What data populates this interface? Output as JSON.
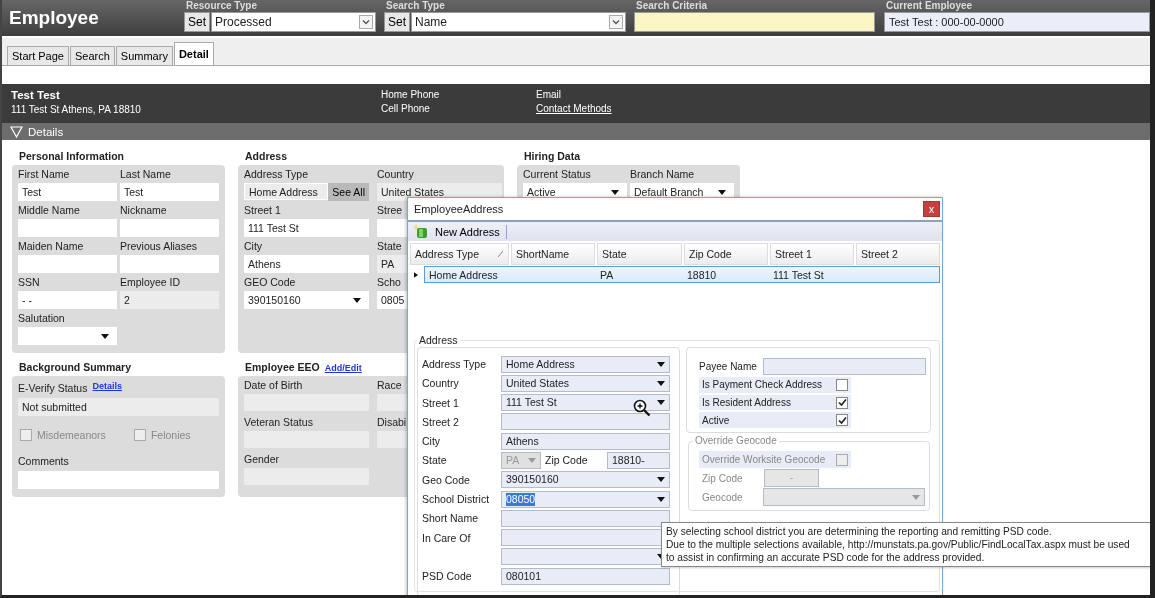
{
  "header": {
    "title": "Employee",
    "groups": [
      {
        "label": "Resource Type",
        "kind": "select",
        "button": "Set",
        "value": "Processed"
      },
      {
        "label": "Search Type",
        "kind": "select",
        "button": "Set",
        "value": "Name"
      },
      {
        "label": "Search Criteria",
        "kind": "input"
      },
      {
        "label": "Current Employee",
        "kind": "display",
        "value": "Test  Test : 000-00-0000"
      }
    ]
  },
  "tabs": [
    {
      "label": "Start Page",
      "selected": false
    },
    {
      "label": "Search",
      "selected": false
    },
    {
      "label": "Summary",
      "selected": false
    },
    {
      "label": "Detail",
      "selected": true
    }
  ],
  "employee": {
    "name": "Test Test",
    "address": "111 Test St Athens, PA 18810",
    "phone_labels": [
      "Home Phone",
      "Cell Phone"
    ],
    "email_label": "Email",
    "contact_link": "Contact Methods"
  },
  "details_bar": {
    "label": "Details",
    "expanded": true
  },
  "personal_information": {
    "title": "Personal Information",
    "fields": [
      {
        "label": "First Name",
        "kind": "input",
        "value": "Test"
      },
      {
        "label": "Last Name",
        "kind": "input",
        "value": "Test"
      },
      {
        "label": "Middle Name",
        "kind": "input"
      },
      {
        "label": "Nickname",
        "kind": "input"
      },
      {
        "label": "Maiden Name",
        "kind": "input"
      },
      {
        "label": "Previous Aliases",
        "kind": "input"
      },
      {
        "label": "SSN",
        "kind": "input",
        "value": "-   -"
      },
      {
        "label": "Employee ID",
        "kind": "readonly",
        "value": "2"
      },
      {
        "label": "Salutation",
        "kind": "select"
      }
    ]
  },
  "address": {
    "title": "Address",
    "fields": [
      {
        "label": "Address Type",
        "kind": "button-field",
        "value": "Home Address",
        "button": "See All"
      },
      {
        "label": "Country",
        "kind": "readonly",
        "value": "United States"
      },
      {
        "label": "Street 1",
        "kind": "input",
        "value": "111 Test St"
      },
      {
        "label": "Stree",
        "kind": "input"
      },
      {
        "label": "City",
        "kind": "input",
        "value": "Athens"
      },
      {
        "label": "State",
        "kind": "readonly",
        "value": "PA"
      },
      {
        "label": "GEO Code",
        "kind": "select",
        "value": "390150160"
      },
      {
        "label": "Scho",
        "kind": "input",
        "value": "0805"
      }
    ]
  },
  "hiring_data": {
    "title": "Hiring Data",
    "fields": [
      {
        "label": "Current Status",
        "kind": "select",
        "value": "Active"
      },
      {
        "label": "Branch Name",
        "kind": "select",
        "value": "Default Branch"
      }
    ]
  },
  "background_summary": {
    "title": "Background Summary",
    "everify_label": "E-Verify Status",
    "details_link": "Details",
    "everify_value": "Not submitted",
    "checks": [
      {
        "label": "Misdemeanors",
        "checked": false,
        "disabled": true
      },
      {
        "label": "Felonies",
        "checked": false,
        "disabled": true
      }
    ],
    "comments_label": "Comments"
  },
  "employee_eeo": {
    "title": "Employee EEO",
    "link": "Add/Edit",
    "fields": [
      {
        "label": "Date of Birth",
        "kind": "readonly"
      },
      {
        "label": "Race",
        "kind": "readonly"
      },
      {
        "label": "Veteran Status",
        "kind": "readonly"
      },
      {
        "label": "Disabi",
        "kind": "readonly"
      },
      {
        "label": "Gender",
        "kind": "readonly"
      }
    ]
  },
  "dialog": {
    "title": "EmployeeAddress",
    "close": "x",
    "toolbar_button": "New Address",
    "columns": [
      {
        "label": "Address Type",
        "sorted": true
      },
      {
        "label": "ShortName",
        "sorted": false
      },
      {
        "label": "State",
        "sorted": false
      },
      {
        "label": "Zip Code",
        "sorted": false
      },
      {
        "label": "Street 1",
        "sorted": false
      },
      {
        "label": "Street 2",
        "sorted": false
      }
    ],
    "rows": [
      {
        "selected": true,
        "cells": [
          "Home Address",
          null,
          "PA",
          "18810",
          "111 Test St",
          null
        ]
      }
    ],
    "form": {
      "legend": "Address",
      "fields": [
        {
          "label": "Address Type",
          "kind": "select",
          "value": "Home Address"
        },
        {
          "label": "Country",
          "kind": "select",
          "value": "United States"
        },
        {
          "label": "Street 1",
          "kind": "select",
          "value": "111 Test St"
        },
        {
          "label": "Street 2",
          "kind": "input"
        },
        {
          "label": "City",
          "kind": "input",
          "value": "Athens"
        },
        {
          "label": "State",
          "kind": "state-zip",
          "value": "PA",
          "zip_label": "Zip Code",
          "zip_value": "18810-"
        },
        {
          "label": "Geo Code",
          "kind": "select",
          "value": "390150160"
        },
        {
          "label": "School District",
          "kind": "select",
          "value": "08050",
          "text_selected": true
        },
        {
          "label": "Short Name",
          "kind": "input"
        },
        {
          "label": "In Care Of",
          "kind": "input"
        },
        {
          "kind": "select"
        },
        {
          "label": "PSD Code",
          "kind": "input",
          "value": "080101"
        }
      ]
    },
    "options": {
      "payee_label": "Payee Name",
      "checks": [
        {
          "label": "Is Payment Check Address",
          "checked": false
        },
        {
          "label": "Is Resident Address",
          "checked": true
        },
        {
          "label": "Active",
          "checked": true
        }
      ]
    },
    "override": {
      "legend": "Override Geocode",
      "disabled": true,
      "check": {
        "label": "Override Worksite Geocode",
        "checked": false
      },
      "zip_label": "Zip Code",
      "zip_value": "-",
      "geocode_label": "Geocode"
    }
  },
  "tooltip": {
    "lines": [
      "By selecting school district you are determining the reporting and remitting PSD code.",
      "Due to the multiple selections available, http://munstats.pa.gov/Public/FindLocalTax.aspx must be used",
      "to assist in confirming an accurate PSD code for the address provided."
    ]
  }
}
